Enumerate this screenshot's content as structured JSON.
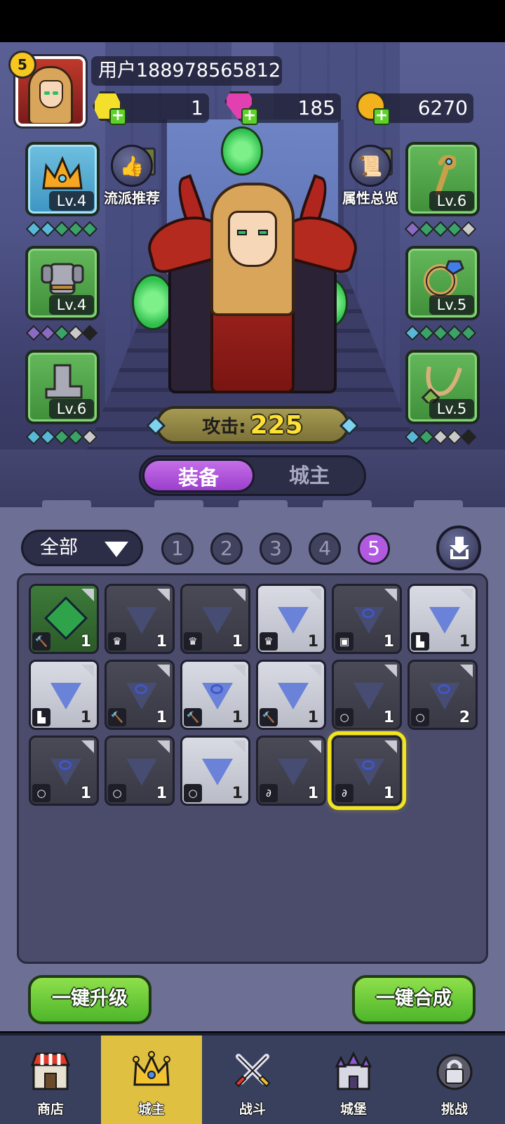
{
  "player": {
    "level": "5",
    "username": "用户188978565812"
  },
  "currencies": [
    {
      "name": "yellow-gem",
      "value": "1",
      "color": "#f4e02a"
    },
    {
      "name": "pink-gem",
      "value": "185",
      "color": "#e23fb0"
    },
    {
      "name": "gold-coin",
      "value": "6270",
      "color": "#f3b11d"
    }
  ],
  "actions": {
    "recommend_label": "流派推荐",
    "stats_label": "属性总览"
  },
  "equipment": {
    "crown": {
      "level": "Lv.4",
      "icon": "crown-icon",
      "gems": [
        "#58b8d8",
        "#58b8d8",
        "#3aa36a",
        "#3aa36a",
        "#3aa36a"
      ]
    },
    "armor": {
      "level": "Lv.4",
      "icon": "armor-icon",
      "gems": [
        "#8a6bc4",
        "#8a6bc4",
        "#3aa36a",
        "#c9c9c9",
        "#222"
      ]
    },
    "boots": {
      "level": "Lv.6",
      "icon": "boots-icon",
      "gems": [
        "#58b8d8",
        "#58b8d8",
        "#3aa36a",
        "#3aa36a",
        "#c9c9c9"
      ]
    },
    "staff": {
      "level": "Lv.6",
      "icon": "staff-icon",
      "gems": [
        "#8a6bc4",
        "#3aa36a",
        "#3aa36a",
        "#3aa36a",
        "#c9c9c9"
      ]
    },
    "ring": {
      "level": "Lv.5",
      "icon": "ring-icon",
      "gems": [
        "#58b8d8",
        "#3aa36a",
        "#3aa36a",
        "#3aa36a",
        "#3aa36a"
      ]
    },
    "necklace": {
      "level": "Lv.5",
      "icon": "necklace-icon",
      "gems": [
        "#58b8d8",
        "#3aa36a",
        "#c9c9c9",
        "#c9c9c9",
        "#222"
      ]
    }
  },
  "attack": {
    "label": "攻击:",
    "value": "225"
  },
  "tabs": {
    "equipment": "装备",
    "lord": "城主"
  },
  "filter": {
    "selected": "全部",
    "tiers": [
      "1",
      "2",
      "3",
      "4",
      "5"
    ],
    "active_tier": "5"
  },
  "inventory": [
    {
      "style": "green",
      "art": "gem",
      "type": "🔨",
      "count": "1"
    },
    {
      "style": "dark",
      "art": "plain",
      "type": "♛",
      "count": "1"
    },
    {
      "style": "dark",
      "art": "plain",
      "type": "♛",
      "count": "1"
    },
    {
      "style": "light",
      "art": "plain",
      "type": "♛",
      "count": "1"
    },
    {
      "style": "dark",
      "art": "swirl",
      "type": "▣",
      "count": "1"
    },
    {
      "style": "light",
      "art": "plain",
      "type": "▙",
      "count": "1"
    },
    {
      "style": "light",
      "art": "plain",
      "type": "▙",
      "count": "1"
    },
    {
      "style": "dark",
      "art": "swirl",
      "type": "🔨",
      "count": "1"
    },
    {
      "style": "light",
      "art": "swirl",
      "type": "🔨",
      "count": "1"
    },
    {
      "style": "light",
      "art": "plain",
      "type": "🔨",
      "count": "1"
    },
    {
      "style": "dark",
      "art": "plain",
      "type": "○",
      "count": "1"
    },
    {
      "style": "dark",
      "art": "swirl",
      "type": "○",
      "count": "2"
    },
    {
      "style": "dark",
      "art": "swirl",
      "type": "○",
      "count": "1"
    },
    {
      "style": "dark",
      "art": "plain",
      "type": "○",
      "count": "1"
    },
    {
      "style": "light",
      "art": "plain",
      "type": "○",
      "count": "1"
    },
    {
      "style": "dark",
      "art": "plain",
      "type": "∂",
      "count": "1"
    },
    {
      "style": "dark",
      "art": "swirl",
      "type": "∂",
      "count": "1",
      "selected": true
    }
  ],
  "buttons": {
    "upgrade_all": "一键升级",
    "merge_all": "一键合成"
  },
  "nav": [
    {
      "label": "商店",
      "icon": "shop-icon"
    },
    {
      "label": "城主",
      "icon": "crown-icon",
      "active": true
    },
    {
      "label": "战斗",
      "icon": "swords-icon"
    },
    {
      "label": "城堡",
      "icon": "castle-icon"
    },
    {
      "label": "挑战",
      "icon": "lock-icon"
    }
  ]
}
